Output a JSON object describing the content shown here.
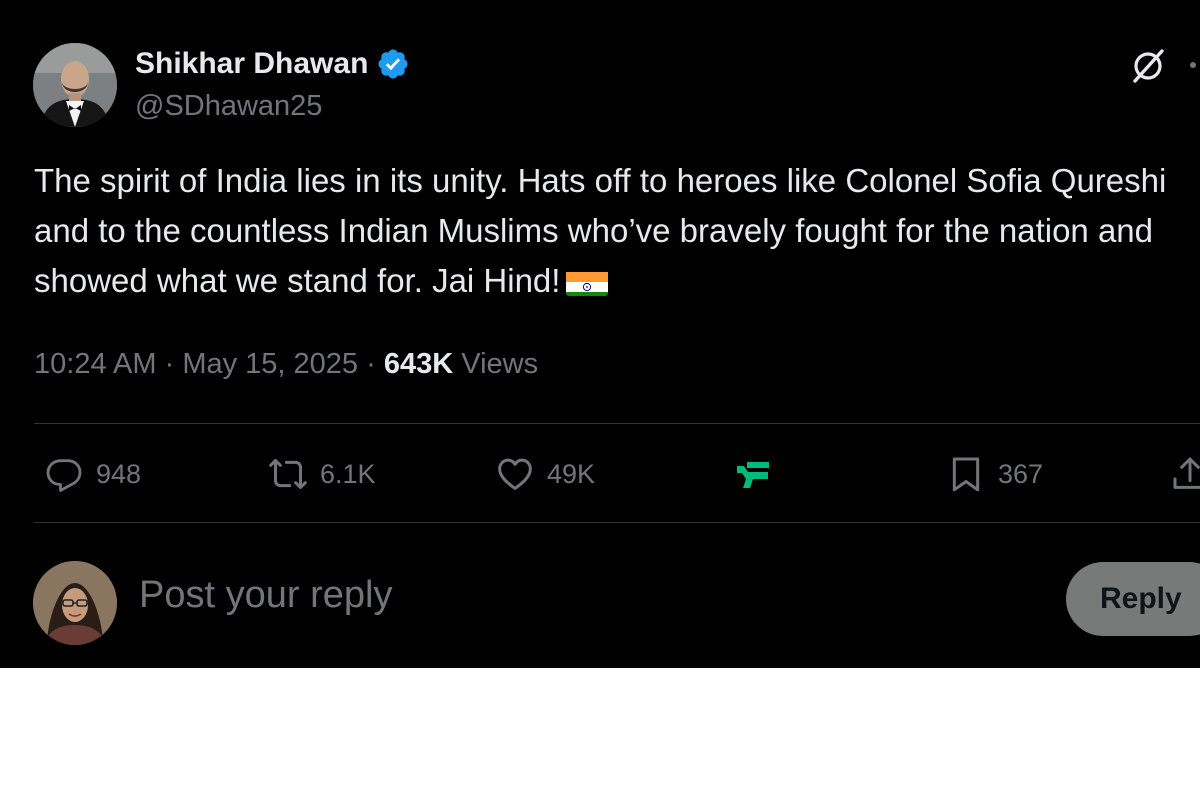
{
  "author": {
    "display_name": "Shikhar Dhawan",
    "handle": "@SDhawan25",
    "verified_icon": "verified-badge-icon"
  },
  "header_icons": [
    "grok-icon",
    "more-icon"
  ],
  "post": {
    "text": "The spirit of India lies in its unity. Hats off to heroes like Colonel Sofia Qureshi and to the countless Indian Muslims who’ve bravely fought for the nation and showed what we stand for. Jai Hind!",
    "emoji": "indian-flag-icon",
    "time": "10:24 AM",
    "date": "May 15, 2025",
    "separator": "·",
    "views_count": "643K",
    "views_label": "Views"
  },
  "actions": {
    "replies": "948",
    "reposts": "6.1K",
    "likes": "49K",
    "bookmarks": "367"
  },
  "composer": {
    "placeholder": "Post your reply",
    "button_label": "Reply"
  },
  "colors": {
    "background": "#000000",
    "text_primary": "#e7e9ea",
    "text_secondary": "#71767b",
    "verified_blue": "#1d9bf0",
    "accent_teal": "#00ba7c"
  }
}
